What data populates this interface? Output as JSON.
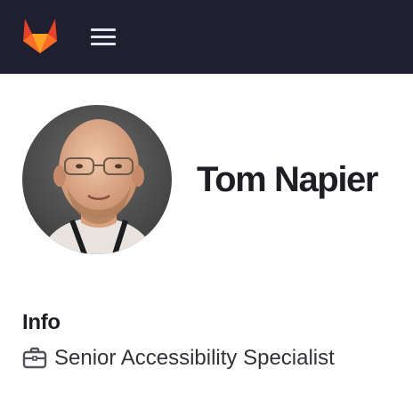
{
  "header": {
    "logo_icon": "gitlab-tanuki-icon",
    "menu_icon": "hamburger-menu-icon",
    "background": "#1f1f2f"
  },
  "profile": {
    "name": "Tom Napier",
    "avatar_alt": "Tom Napier"
  },
  "info": {
    "title": "Info",
    "job_icon": "briefcase-icon",
    "job_title": "Senior Accessibility Specialist"
  }
}
